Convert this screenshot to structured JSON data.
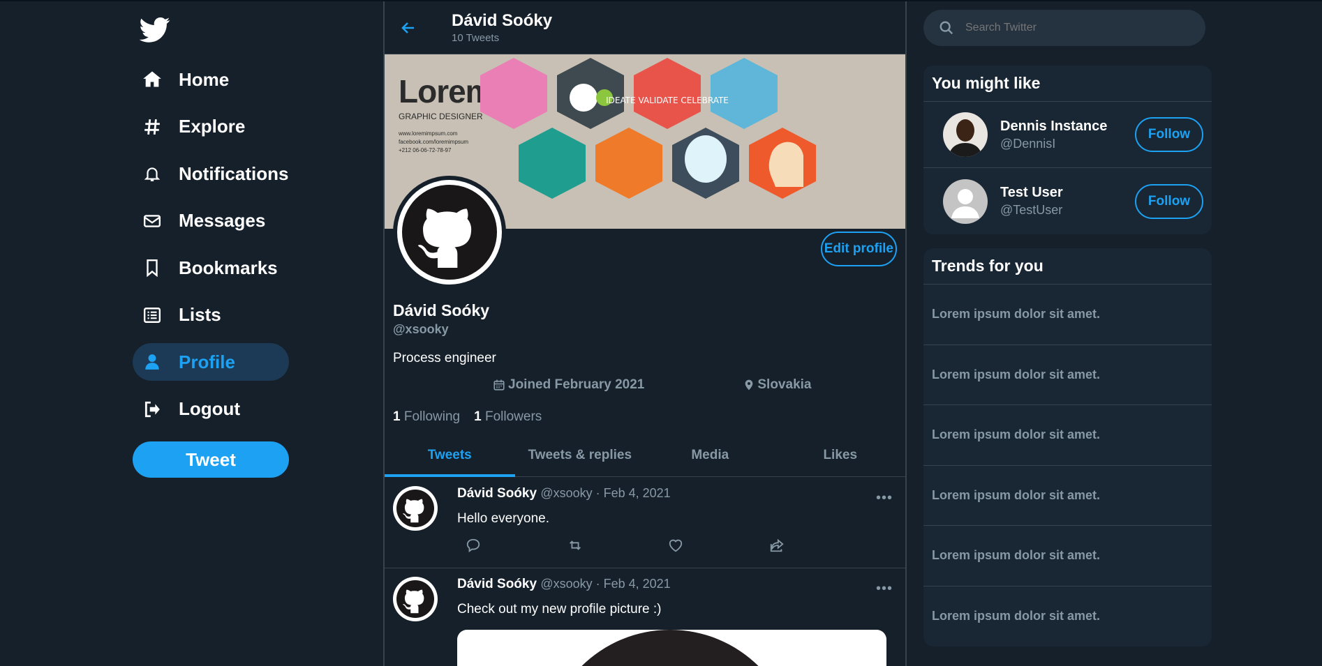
{
  "nav": {
    "items": [
      {
        "label": "Home",
        "icon": "home-icon"
      },
      {
        "label": "Explore",
        "icon": "hashtag-icon"
      },
      {
        "label": "Notifications",
        "icon": "bell-icon"
      },
      {
        "label": "Messages",
        "icon": "envelope-icon"
      },
      {
        "label": "Bookmarks",
        "icon": "bookmark-icon"
      },
      {
        "label": "Lists",
        "icon": "list-icon"
      },
      {
        "label": "Profile",
        "icon": "user-icon"
      },
      {
        "label": "Logout",
        "icon": "logout-icon"
      }
    ],
    "tweet_label": "Tweet"
  },
  "header": {
    "name": "Dávid Soóky",
    "tweet_count": "10 Tweets"
  },
  "banner": {
    "title": "Lorem",
    "subtitle": "GRAPHIC DESIGNER",
    "line1": "www.loremimpsum.com",
    "line2": "facebook.com/loremimpsum",
    "line3": "+212 06-06-72-78-97",
    "hex_text": "IDEATE VALIDATE CELEBRATE"
  },
  "profile": {
    "name": "Dávid Soóky",
    "handle": "@xsooky",
    "bio": "Process engineer",
    "joined": "Joined February 2021",
    "location": "Slovakia",
    "following_count": "1",
    "following_label": "Following",
    "followers_count": "1",
    "followers_label": "Followers",
    "edit_label": "Edit profile"
  },
  "tabs": [
    "Tweets",
    "Tweets & replies",
    "Media",
    "Likes"
  ],
  "tweets": [
    {
      "name": "Dávid Soóky",
      "handle": "@xsooky",
      "date": " · Feb 4, 2021",
      "text": "Hello everyone."
    },
    {
      "name": "Dávid Soóky",
      "handle": "@xsooky",
      "date": " · Feb 4, 2021",
      "text": "Check out my new profile picture :)"
    }
  ],
  "search": {
    "placeholder": "Search Twitter"
  },
  "who_to_follow": {
    "title": "You might like",
    "users": [
      {
        "name": "Dennis Instance",
        "handle": "@DennisI",
        "follow_label": "Follow"
      },
      {
        "name": "Test User",
        "handle": "@TestUser",
        "follow_label": "Follow"
      }
    ]
  },
  "trends": {
    "title": "Trends for you",
    "items": [
      "Lorem ipsum dolor sit amet.",
      "Lorem ipsum dolor sit amet.",
      "Lorem ipsum dolor sit amet.",
      "Lorem ipsum dolor sit amet.",
      "Lorem ipsum dolor sit amet.",
      "Lorem ipsum dolor sit amet."
    ]
  },
  "colors": {
    "background": "#15202b",
    "accent": "#1da1f2",
    "panel": "#192734",
    "muted": "#8899a6"
  }
}
